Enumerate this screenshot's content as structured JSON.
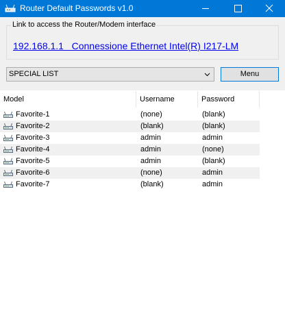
{
  "window": {
    "title": "Router Default Passwords v1.0",
    "icon": "router-icon",
    "controls": [
      "minimize-icon",
      "maximize-icon",
      "close-icon"
    ]
  },
  "link_group": {
    "legend": "Link to access the Router/Modem interface",
    "link_text": "192.168.1.1   Connessione Ethernet Intel(R) I217-LM"
  },
  "combo": {
    "selected": "SPECIAL LIST"
  },
  "menu_button": {
    "label": "Menu"
  },
  "list": {
    "columns": [
      "Model",
      "Username",
      "Password"
    ],
    "row_icon": "router-icon",
    "rows": [
      {
        "model": "Favorite-1",
        "username": "(none)",
        "password": "(blank)"
      },
      {
        "model": "Favorite-2",
        "username": "(blank)",
        "password": "(blank)"
      },
      {
        "model": "Favorite-3",
        "username": "admin",
        "password": "admin"
      },
      {
        "model": "Favorite-4",
        "username": "admin",
        "password": "(none)"
      },
      {
        "model": "Favorite-5",
        "username": "admin",
        "password": "(blank)"
      },
      {
        "model": "Favorite-6",
        "username": "(none)",
        "password": "admin"
      },
      {
        "model": "Favorite-7",
        "username": "(blank)",
        "password": "admin"
      }
    ]
  },
  "colors": {
    "titlebar": "#0078d7",
    "link": "#0000ee",
    "alt_row": "#f0f0f0",
    "client_bg": "#f0f0f0"
  }
}
